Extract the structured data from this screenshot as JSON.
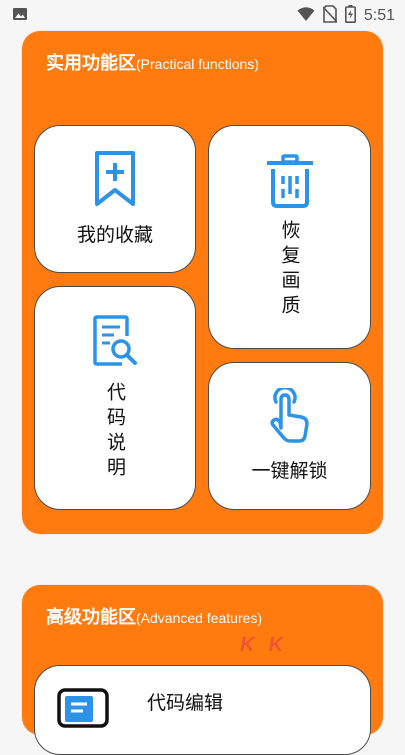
{
  "status_bar": {
    "time": "5:51",
    "icons": [
      "image-icon",
      "wifi-icon",
      "no-sim-icon",
      "battery-icon"
    ]
  },
  "practical": {
    "title_zh": "实用功能区",
    "title_en": "(Practical functions)",
    "cards": {
      "favorites": "我的收藏",
      "restore": "恢复画质",
      "code_explain": "代码说明",
      "unlock": "一键解锁"
    }
  },
  "advanced": {
    "title_zh": "高级功能区",
    "title_en": "(Advanced features)",
    "cards": {
      "code_edit": "代码编辑"
    }
  },
  "watermark": "KK",
  "colors": {
    "accent": "#ff7a0f",
    "icon_blue": "#2d93e6",
    "card_border": "#4b4b4b"
  }
}
